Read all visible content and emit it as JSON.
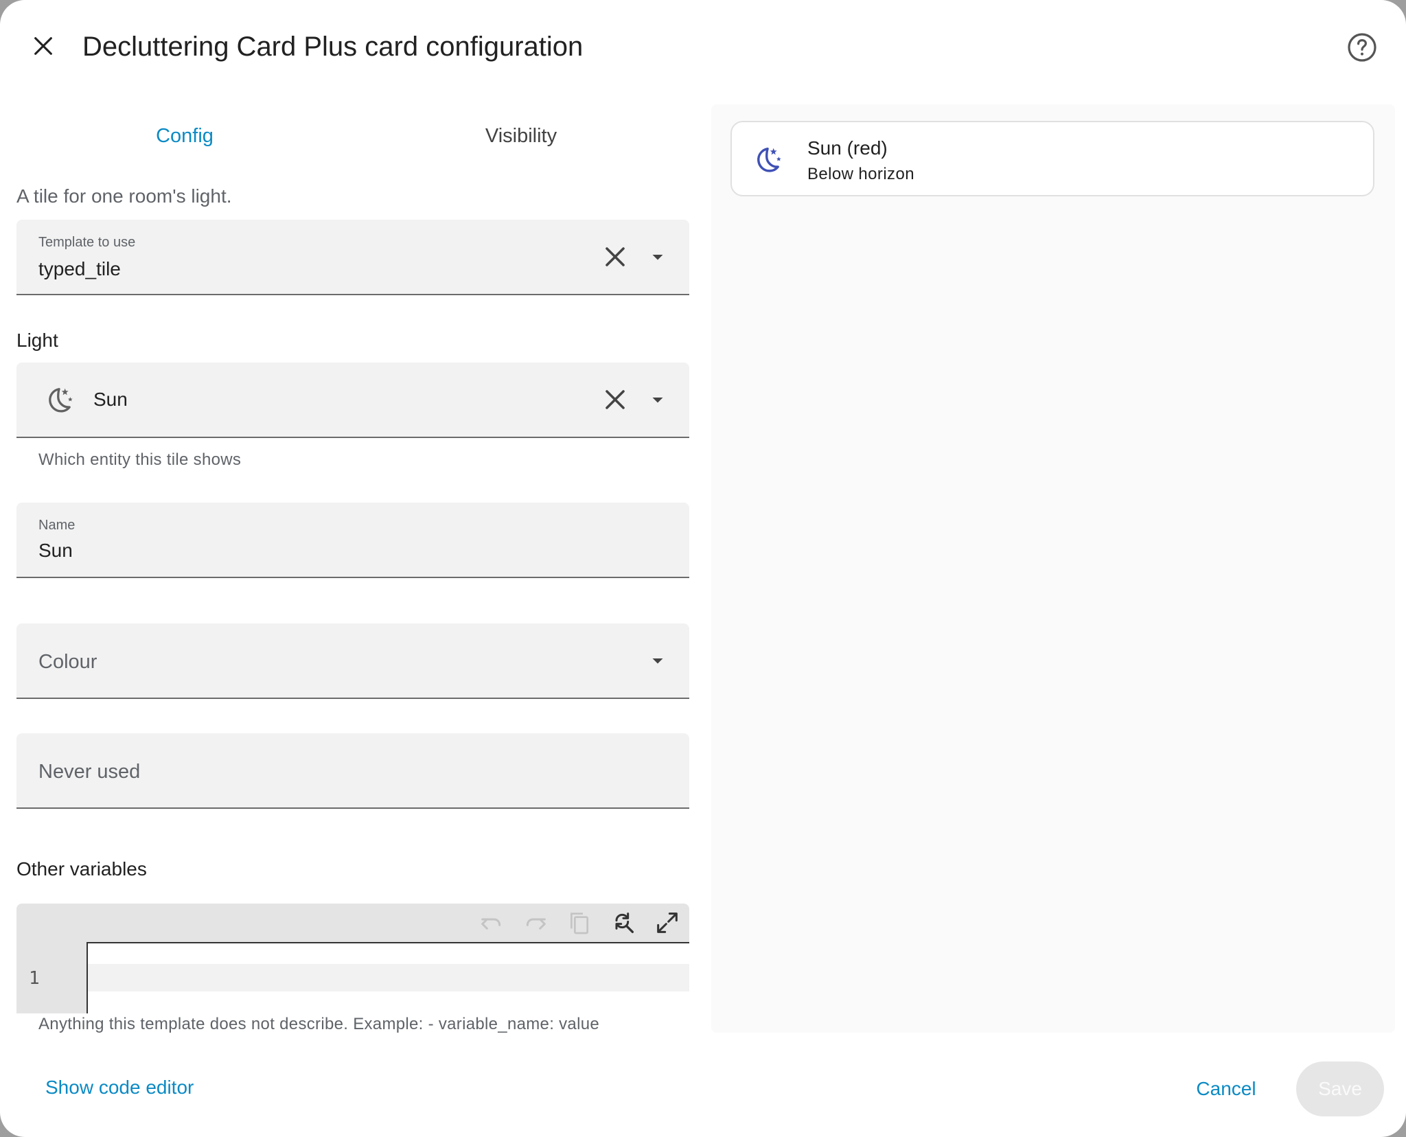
{
  "dialog": {
    "title": "Decluttering Card Plus card configuration",
    "close_icon": "close-icon",
    "help_icon": "help-circle-icon"
  },
  "tabs": [
    {
      "label": "Config",
      "active": true
    },
    {
      "label": "Visibility",
      "active": false
    }
  ],
  "form": {
    "description": "A tile for one room's light.",
    "template": {
      "label": "Template to use",
      "value": "typed_tile"
    },
    "light": {
      "section_label": "Light",
      "entity_name": "Sun",
      "entity_icon": "weather-night-icon",
      "helper": "Which entity this tile shows"
    },
    "name": {
      "label": "Name",
      "value": "Sun"
    },
    "colour": {
      "placeholder": "Colour"
    },
    "never_used": {
      "placeholder": "Never used"
    },
    "other_variables": {
      "section_label": "Other variables",
      "line_number": "1",
      "helper": "Anything this template does not describe. Example: - variable_name: value",
      "toolbar_icons": [
        "undo-icon",
        "redo-icon",
        "copy-icon",
        "find-replace-icon",
        "fullscreen-icon"
      ]
    }
  },
  "preview": {
    "tile_name": "Sun (red)",
    "tile_state": "Below horizon",
    "icon_color": "#3f51b5"
  },
  "footer": {
    "show_code_editor": "Show code editor",
    "cancel": "Cancel",
    "save": "Save"
  },
  "colors": {
    "accent": "#0b8ac4",
    "field_bg": "#f2f2f2"
  }
}
